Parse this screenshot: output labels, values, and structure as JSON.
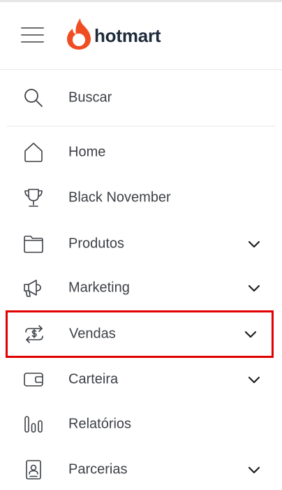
{
  "brand": {
    "name": "hotmart",
    "flame_color": "#ef4e23"
  },
  "search": {
    "label": "Buscar",
    "icon": "search-icon"
  },
  "menu": [
    {
      "id": "home",
      "label": "Home",
      "icon": "home-icon",
      "has_submenu": false
    },
    {
      "id": "black-november",
      "label": "Black November",
      "icon": "trophy-icon",
      "has_submenu": false
    },
    {
      "id": "produtos",
      "label": "Produtos",
      "icon": "folder-icon",
      "has_submenu": true
    },
    {
      "id": "marketing",
      "label": "Marketing",
      "icon": "megaphone-icon",
      "has_submenu": true
    },
    {
      "id": "vendas",
      "label": "Vendas",
      "icon": "money-exchange-icon",
      "has_submenu": true,
      "highlighted": true
    },
    {
      "id": "carteira",
      "label": "Carteira",
      "icon": "wallet-icon",
      "has_submenu": true
    },
    {
      "id": "relatorios",
      "label": "Relatórios",
      "icon": "bar-chart-icon",
      "has_submenu": false
    },
    {
      "id": "parcerias",
      "label": "Parcerias",
      "icon": "badge-icon",
      "has_submenu": true
    }
  ],
  "colors": {
    "text": "#3d4046",
    "icon": "#3d4046",
    "highlight": "#e00000",
    "divider": "#e9e9e9"
  }
}
